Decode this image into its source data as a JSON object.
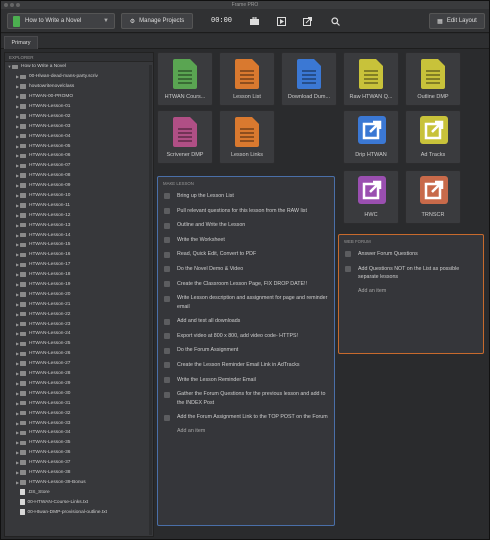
{
  "window": {
    "title": "Frame PRO"
  },
  "toolbar": {
    "project_name": "How to Write a Novel",
    "manage_label": "Manage Projects",
    "timer": "00:00",
    "edit_layout_label": "Edit Layout"
  },
  "tabs": [
    {
      "label": "Primary"
    }
  ],
  "sidebar": {
    "header": "Explorer",
    "root": "How to Write a Novel",
    "items": [
      {
        "label": "00-Hlwan-dead-mans-party.scriv",
        "type": "folder"
      },
      {
        "label": "howtowritenovelclass",
        "type": "folder"
      },
      {
        "label": "HTWAN-00-PROMO",
        "type": "folder"
      },
      {
        "label": "HTWAN-Lesson-01",
        "type": "folder"
      },
      {
        "label": "HTWAN-Lesson-02",
        "type": "folder"
      },
      {
        "label": "HTWAN-Lesson-03",
        "type": "folder"
      },
      {
        "label": "HTWAN-Lesson-04",
        "type": "folder"
      },
      {
        "label": "HTWAN-Lesson-05",
        "type": "folder"
      },
      {
        "label": "HTWAN-Lesson-06",
        "type": "folder"
      },
      {
        "label": "HTWAN-Lesson-07",
        "type": "folder"
      },
      {
        "label": "HTWAN-Lesson-08",
        "type": "folder"
      },
      {
        "label": "HTWAN-Lesson-09",
        "type": "folder"
      },
      {
        "label": "HTWAN-Lesson-10",
        "type": "folder"
      },
      {
        "label": "HTWAN-Lesson-11",
        "type": "folder"
      },
      {
        "label": "HTWAN-Lesson-12",
        "type": "folder"
      },
      {
        "label": "HTWAN-Lesson-13",
        "type": "folder"
      },
      {
        "label": "HTWAN-Lesson-14",
        "type": "folder"
      },
      {
        "label": "HTWAN-Lesson-15",
        "type": "folder"
      },
      {
        "label": "HTWAN-Lesson-16",
        "type": "folder"
      },
      {
        "label": "HTWAN-Lesson-17",
        "type": "folder"
      },
      {
        "label": "HTWAN-Lesson-18",
        "type": "folder"
      },
      {
        "label": "HTWAN-Lesson-19",
        "type": "folder"
      },
      {
        "label": "HTWAN-Lesson-20",
        "type": "folder"
      },
      {
        "label": "HTWAN-Lesson-21",
        "type": "folder"
      },
      {
        "label": "HTWAN-Lesson-22",
        "type": "folder"
      },
      {
        "label": "HTWAN-Lesson-23",
        "type": "folder"
      },
      {
        "label": "HTWAN-Lesson-24",
        "type": "folder"
      },
      {
        "label": "HTWAN-Lesson-25",
        "type": "folder"
      },
      {
        "label": "HTWAN-Lesson-26",
        "type": "folder"
      },
      {
        "label": "HTWAN-Lesson-27",
        "type": "folder"
      },
      {
        "label": "HTWAN-Lesson-28",
        "type": "folder"
      },
      {
        "label": "HTWAN-Lesson-29",
        "type": "folder"
      },
      {
        "label": "HTWAN-Lesson-30",
        "type": "folder"
      },
      {
        "label": "HTWAN-Lesson-31",
        "type": "folder"
      },
      {
        "label": "HTWAN-Lesson-32",
        "type": "folder"
      },
      {
        "label": "HTWAN-Lesson-33",
        "type": "folder"
      },
      {
        "label": "HTWAN-Lesson-34",
        "type": "folder"
      },
      {
        "label": "HTWAN-Lesson-35",
        "type": "folder"
      },
      {
        "label": "HTWAN-Lesson-36",
        "type": "folder"
      },
      {
        "label": "HTWAN-Lesson-37",
        "type": "folder"
      },
      {
        "label": "HTWAN-Lesson-38",
        "type": "folder"
      },
      {
        "label": "HTWAN-Lesson-39-Bonus",
        "type": "folder"
      },
      {
        "label": ".DS_Store",
        "type": "file"
      },
      {
        "label": "00-HTWAN-Course-Links.txt",
        "type": "file"
      },
      {
        "label": "00-Htwan-DMP-provisional-outline.txt",
        "type": "file"
      }
    ]
  },
  "cards": [
    {
      "label": "HTWAN Cours...",
      "color": "#5aa552",
      "kind": "doc"
    },
    {
      "label": "Lesson List",
      "color": "#d9792f",
      "kind": "doc"
    },
    {
      "label": "Download Dum...",
      "color": "#3b78d4",
      "kind": "doc"
    },
    {
      "label": "Raw HTWAN Q...",
      "color": "#c8c23a",
      "kind": "doc"
    },
    {
      "label": "Outline DMP",
      "color": "#c8c23a",
      "kind": "doc"
    },
    {
      "label": "Scrivener DMP",
      "color": "#b04f85",
      "kind": "doc"
    },
    {
      "label": "Lesson Links",
      "color": "#d9792f",
      "kind": "doc"
    },
    {
      "label": "Drip HTWAN",
      "color": "#3b78d4",
      "kind": "link"
    },
    {
      "label": "Ad Tracks",
      "color": "#c8c23a",
      "kind": "link"
    },
    {
      "label": "HWC",
      "color": "#9a4fb0",
      "kind": "link"
    },
    {
      "label": "TRNSCR",
      "color": "#c86a4a",
      "kind": "link"
    }
  ],
  "checklist": {
    "header": "Make Lesson",
    "items": [
      "Bring up the Lesson List",
      "Pull relevant questions for this lesson from the RAW list",
      "Outline and Write the Lesson",
      "Write the Worksheet",
      "Read, Quick Edit, Convert to PDF",
      "Do the Novel Demo & Video",
      "Create the Classroom Lesson Page, FIX DROP DATE!!",
      "Write Lesson description and assignment for page and reminder email",
      "Add and test all downloads",
      "Export video at 800 x 800, add video code- HTTPS!",
      "Do the Forum Assignment",
      "Create the Lesson Reminder Email Link in AdTracks",
      "Write the Lesson Reminder Email",
      "Gather the Forum Questions for the previous lesson and add to the INDEX Post",
      "Add the Forum Assignment Link to the TOP POST on the Forum"
    ],
    "add_label": "Add an item"
  },
  "forum_list": {
    "header": "Web Forum",
    "items": [
      "Answer Forum Questions",
      "Add Questions NOT on the List as possible separate lessons"
    ],
    "add_label": "Add an item"
  }
}
